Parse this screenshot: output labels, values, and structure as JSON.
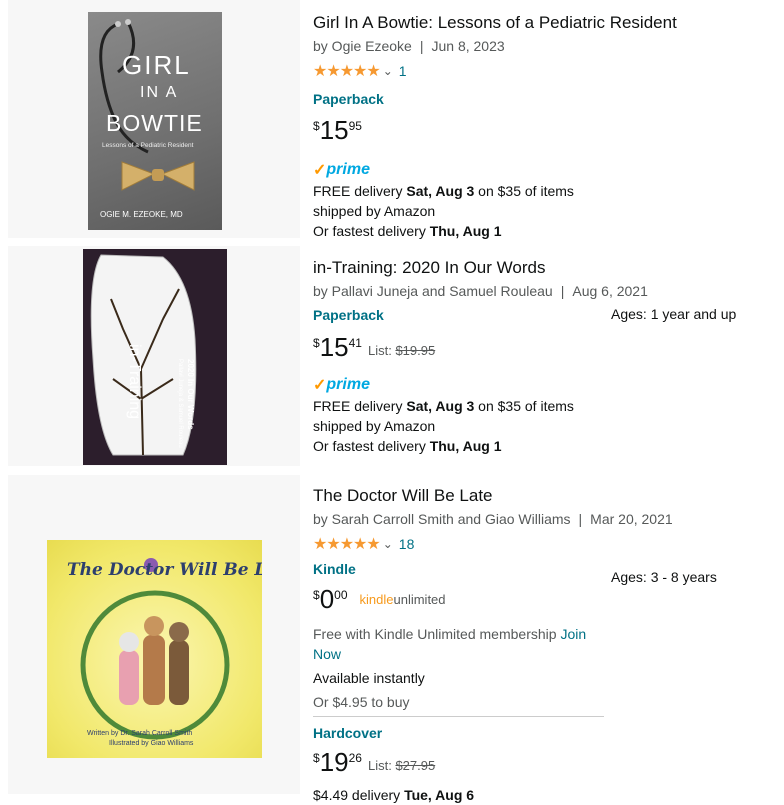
{
  "results": [
    {
      "title": "Girl In A Bowtie: Lessons of a Pediatric Resident",
      "author": "by Ogie Ezeoke",
      "date": "Jun 8, 2023",
      "rating_count": "1",
      "format": "Paperback",
      "price": {
        "symbol": "$",
        "whole": "15",
        "fraction": "95"
      },
      "prime": {
        "check": "✓",
        "word": "prime"
      },
      "delivery": {
        "prefix": "FREE delivery ",
        "day": "Sat, Aug 3",
        "suffix": " on $35 of items",
        "shipped": "shipped by Amazon",
        "fast_prefix": "Or fastest delivery ",
        "fast_day": "Thu, Aug 1"
      },
      "cover": {
        "line1": "GIRL",
        "line2": "IN A",
        "line3": "BOWTIE",
        "subtitle": "Lessons of a Pediatric Resident",
        "author": "OGIE M. EZEOKE, MD"
      }
    },
    {
      "title": "in-Training: 2020 In Our Words",
      "author": "by Pallavi Juneja and Samuel Rouleau",
      "date": "Aug 6, 2021",
      "format": "Paperback",
      "ages": "Ages: 1 year and up",
      "price": {
        "symbol": "$",
        "whole": "15",
        "fraction": "41",
        "list_label": "List:",
        "list_price": "$19.95"
      },
      "prime": {
        "check": "✓",
        "word": "prime"
      },
      "delivery": {
        "prefix": "FREE delivery ",
        "day": "Sat, Aug 3",
        "suffix": " on $35 of items",
        "shipped": "shipped by Amazon",
        "fast_prefix": "Or fastest delivery ",
        "fast_day": "Thu, Aug 1"
      },
      "cover": {
        "title": "in-Training",
        "subtitle": "2020 In Our Words",
        "editors": "Pallavi Juneja & Samuel Rouleau"
      }
    },
    {
      "title": "The Doctor Will Be Late",
      "author": "by Sarah Carroll Smith and Giao Williams",
      "date": "Mar 20, 2021",
      "rating_count": "18",
      "format": "Kindle",
      "ages": "Ages: 3 - 8 years",
      "price": {
        "symbol": "$",
        "whole": "0",
        "fraction": "00"
      },
      "kindle_unlimited": {
        "kindle": "kindle",
        "unlimited": "unlimited"
      },
      "ku_text": "Free with Kindle Unlimited membership ",
      "ku_link": "Join Now",
      "available": "Available instantly",
      "buy_alt": "Or $4.95 to buy",
      "format2": "Hardcover",
      "price2": {
        "symbol": "$",
        "whole": "19",
        "fraction": "26",
        "list_label": "List:",
        "list_price": "$27.95"
      },
      "delivery2": {
        "prefix": "$4.49 delivery ",
        "day": "Tue, Aug 6"
      },
      "cover": {
        "title": "The Doctor Will Be Late",
        "credits1": "Written by Dr. Sarah Carroll Smith",
        "credits2": "Illustrated by Giao Williams"
      }
    }
  ],
  "stars": "★★★★★",
  "chevron": "⌄",
  "colors": {
    "link": "#007185",
    "star": "#f69931",
    "prime": "#00a8e1",
    "panel": "#f7f7f7"
  }
}
